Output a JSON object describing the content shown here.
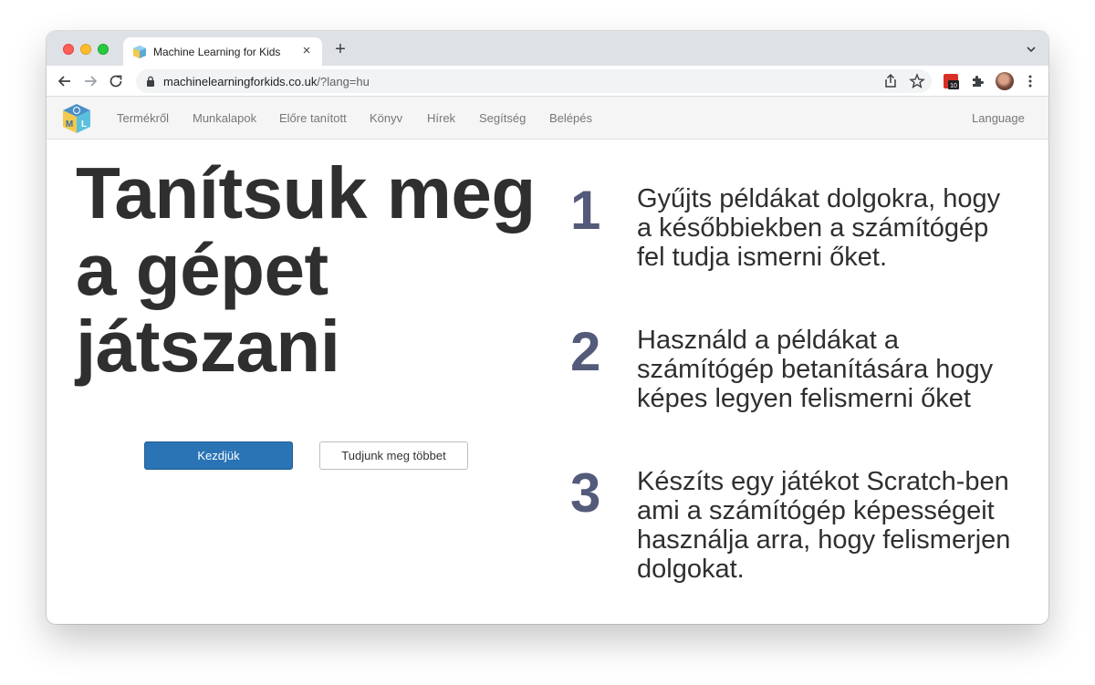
{
  "browser": {
    "tab_title": "Machine Learning for Kids",
    "tab_close": "×",
    "new_tab": "+",
    "url_host": "machinelearningforkids.co.uk",
    "url_path": "/?lang=hu",
    "extension_badge": "10"
  },
  "site": {
    "logo_letters": [
      "M",
      "L"
    ],
    "nav": [
      "Termékről",
      "Munkalapok",
      "Előre tanított",
      "Könyv",
      "Hírek",
      "Segítség",
      "Belépés"
    ],
    "language": "Language"
  },
  "hero": {
    "headline_lines": [
      "Tanítsuk meg",
      "a gépet",
      "játszani"
    ],
    "primary_button": "Kezdjük",
    "secondary_button": "Tudjunk meg többet"
  },
  "steps": [
    {
      "number": "1",
      "lines": [
        "Gyűjts példákat dolgokra, hogy",
        "a későbbiekben a számítógép",
        "fel tudja ismerni őket."
      ]
    },
    {
      "number": "2",
      "lines": [
        "Használd a példákat a",
        "számítógép betanítására hogy",
        "képes legyen felismerni őket"
      ]
    },
    {
      "number": "3",
      "lines": [
        "Készíts egy játékot Scratch-ben",
        "ami a számítógép képességeit",
        "használja arra, hogy felismerjen",
        "dolgokat."
      ]
    }
  ],
  "colors": {
    "primary_button": "#2a74b5",
    "step_number": "#545a7a",
    "text": "#2f2f2f"
  }
}
